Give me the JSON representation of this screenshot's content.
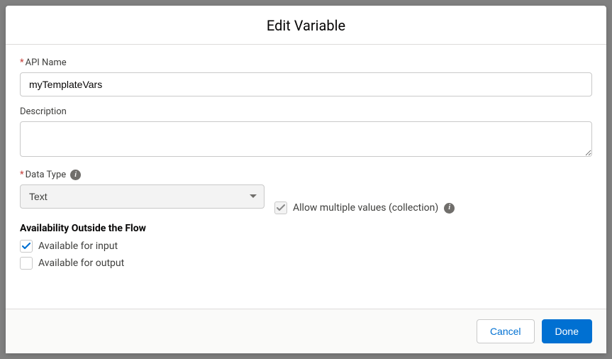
{
  "modal": {
    "title": "Edit Variable"
  },
  "fields": {
    "api_name": {
      "label": "API Name",
      "value": "myTemplateVars"
    },
    "description": {
      "label": "Description",
      "value": ""
    },
    "data_type": {
      "label": "Data Type",
      "value": "Text"
    },
    "collection": {
      "label": "Allow multiple values (collection)",
      "checked": true
    }
  },
  "availability": {
    "heading": "Availability Outside the Flow",
    "input": {
      "label": "Available for input",
      "checked": true
    },
    "output": {
      "label": "Available for output",
      "checked": false
    }
  },
  "footer": {
    "cancel": "Cancel",
    "done": "Done"
  }
}
